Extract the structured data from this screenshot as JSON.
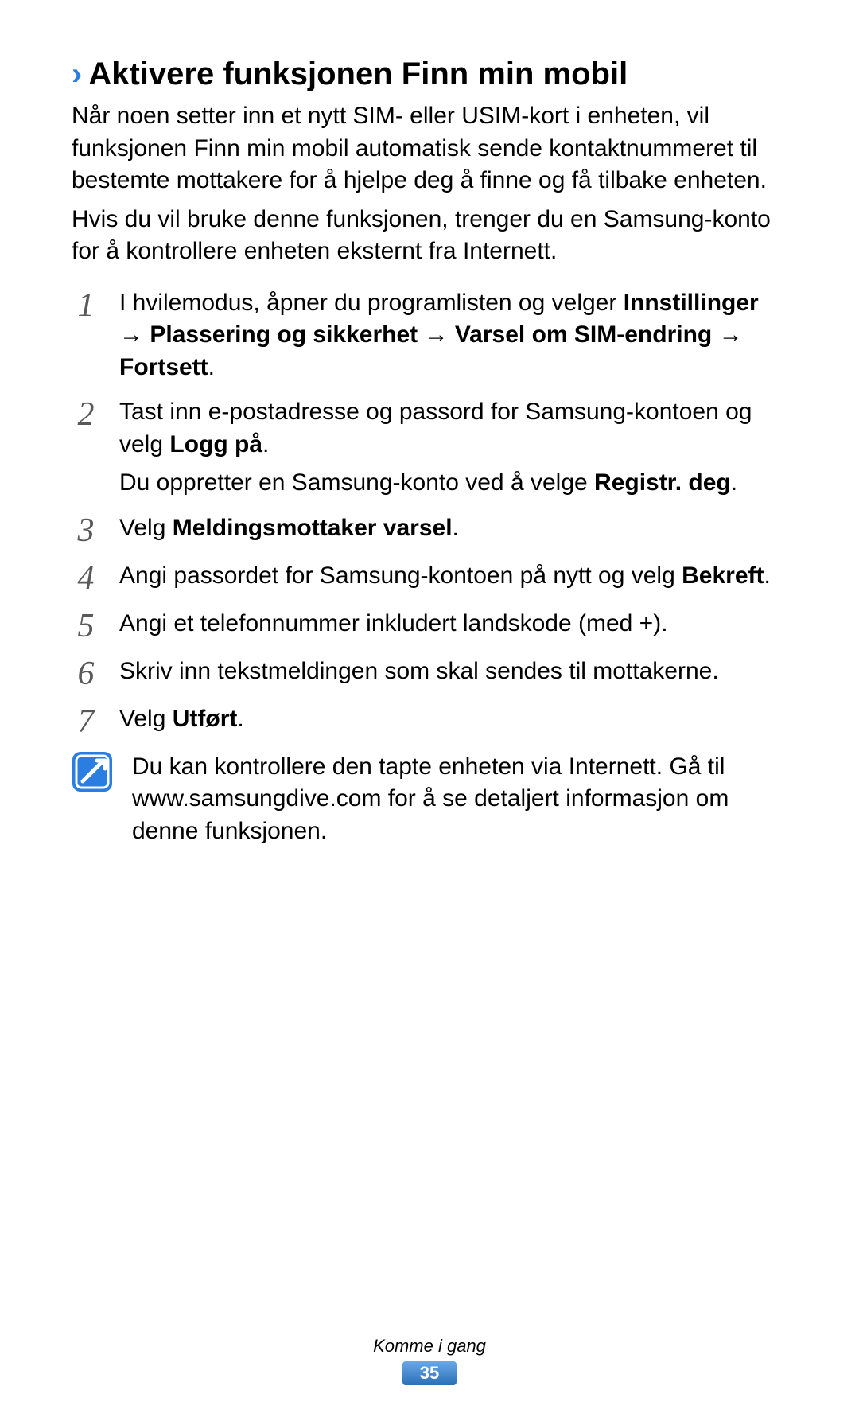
{
  "heading": "Aktivere funksjonen Finn min mobil",
  "intro": {
    "p1": "Når noen setter inn et nytt SIM- eller USIM-kort i enheten, vil funksjonen Finn min mobil automatisk sende kontaktnummeret til bestemte mottakere for å hjelpe deg å finne og få tilbake enheten.",
    "p2": "Hvis du vil bruke denne funksjonen, trenger du en Samsung-konto for å kontrollere enheten eksternt fra Internett."
  },
  "steps": {
    "s1": {
      "num": "1",
      "lead": "I hvilemodus, åpner du programlisten og velger ",
      "b1": "Innstillinger",
      "arr1": " → ",
      "b2": "Plassering og sikkerhet",
      "arr2": " → ",
      "b3": "Varsel om SIM-endring",
      "arr3": " → ",
      "b4": "Fortsett",
      "tail": "."
    },
    "s2": {
      "num": "2",
      "lead": "Tast inn e-postadresse og passord for Samsung-kontoen og velg ",
      "b1": "Logg på",
      "tail": ".",
      "sub_lead": "Du oppretter en Samsung-konto ved å velge ",
      "sub_b1": "Registr. deg",
      "sub_tail": "."
    },
    "s3": {
      "num": "3",
      "lead": "Velg ",
      "b1": "Meldingsmottaker varsel",
      "tail": "."
    },
    "s4": {
      "num": "4",
      "lead": "Angi passordet for Samsung-kontoen på nytt og velg ",
      "b1": "Bekreft",
      "tail": "."
    },
    "s5": {
      "num": "5",
      "text": "Angi et telefonnummer inkludert landskode (med +)."
    },
    "s6": {
      "num": "6",
      "text": "Skriv inn tekstmeldingen som skal sendes til mottakerne."
    },
    "s7": {
      "num": "7",
      "lead": "Velg ",
      "b1": "Utført",
      "tail": "."
    }
  },
  "note": "Du kan kontrollere den tapte enheten via Internett. Gå til www.samsungdive.com for å se detaljert informasjon om denne funksjonen.",
  "footer": {
    "section": "Komme i gang",
    "page": "35"
  }
}
